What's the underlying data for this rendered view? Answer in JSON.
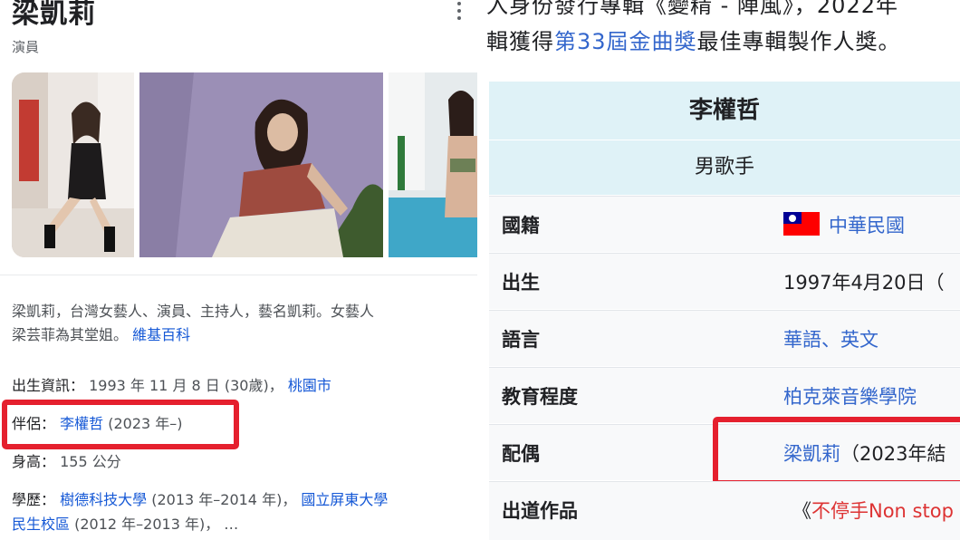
{
  "left_panel": {
    "title": "梁凱莉",
    "subtitle": "演員",
    "description_text": "梁凱莉，台灣女藝人、演員、主持人，藝名凱莉。女藝人",
    "description_text2": "梁芸菲為其堂姐。",
    "description_source": "維基百科",
    "birth": {
      "label": "出生資訊：",
      "value": "1993 年 11 月 8 日 (30歲)，",
      "place": "桃園市"
    },
    "partner": {
      "label": "伴侶：",
      "name": "李權哲",
      "years": "(2023 年–)"
    },
    "height": {
      "label": "身高：",
      "value": "155 公分"
    },
    "education": {
      "label": "學歷：",
      "school1": "樹德科技大學",
      "school1_years": "(2013 年–2014 年)，",
      "school2": "國立屏東大學",
      "school2_line2": "民生校區",
      "school2_years": "(2012 年–2013 年)，  …"
    }
  },
  "right_panel": {
    "top_text_line1": "入身份發行專輯《變精 - 陣風》，2022年",
    "top_text_line2_pre": "輯獲得",
    "top_text_line2_link": "第33屆金曲獎",
    "top_text_line2_post": "最佳專輯製作人獎。",
    "infobox": {
      "name": "李權哲",
      "role": "男歌手",
      "rows": [
        {
          "label": "國籍",
          "value": "中華民國"
        },
        {
          "label": "出生",
          "value": "1997年4月20日（"
        },
        {
          "label": "語言",
          "value": "華語、英文"
        },
        {
          "label": "教育程度",
          "value": "柏克萊音樂學院"
        },
        {
          "label": "配偶",
          "value": "梁凱莉",
          "value_extra": "（2023年結"
        },
        {
          "label": "出道作品",
          "value_pre": "《",
          "value": "不停手Non stop"
        }
      ]
    }
  },
  "colors": {
    "highlight_box": "#e5202e",
    "link_blue": "#1a0dab",
    "wiki_link": "#3366cc",
    "infobox_header": "#dff2f7"
  }
}
